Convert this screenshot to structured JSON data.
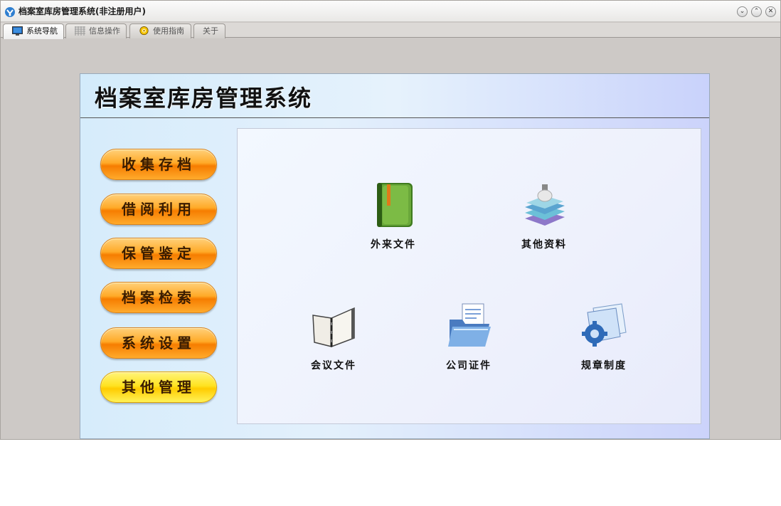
{
  "window": {
    "title": "档案室库房管理系统(非注册用户)",
    "controls": {
      "minimize": "⌄",
      "maximize": "⌃",
      "close": "✕"
    }
  },
  "tabs": [
    {
      "label": "系统导航",
      "icon": "monitor-icon",
      "active": true
    },
    {
      "label": "信息操作",
      "icon": "grid-icon",
      "active": false
    },
    {
      "label": "使用指南",
      "icon": "help-icon",
      "active": false
    },
    {
      "label": "关于",
      "icon": "",
      "active": false
    }
  ],
  "header": {
    "title": "档案室库房管理系统"
  },
  "sidebar": {
    "buttons": [
      {
        "label": "收集存档"
      },
      {
        "label": "借阅利用"
      },
      {
        "label": "保管鉴定"
      },
      {
        "label": "档案检索"
      },
      {
        "label": "系统设置"
      },
      {
        "label": "其他管理"
      }
    ]
  },
  "modules": [
    {
      "label": "外来文件",
      "icon": "green-book-icon"
    },
    {
      "label": "其他资料",
      "icon": "book-stack-icon"
    },
    {
      "label": "会议文件",
      "icon": "open-binder-icon"
    },
    {
      "label": "公司证件",
      "icon": "document-folder-icon"
    },
    {
      "label": "规章制度",
      "icon": "settings-document-icon"
    }
  ],
  "colors": {
    "button_orange": "#ff9a1a",
    "button_yellow": "#ffe322",
    "panel_blue": "#d6ecfb"
  }
}
